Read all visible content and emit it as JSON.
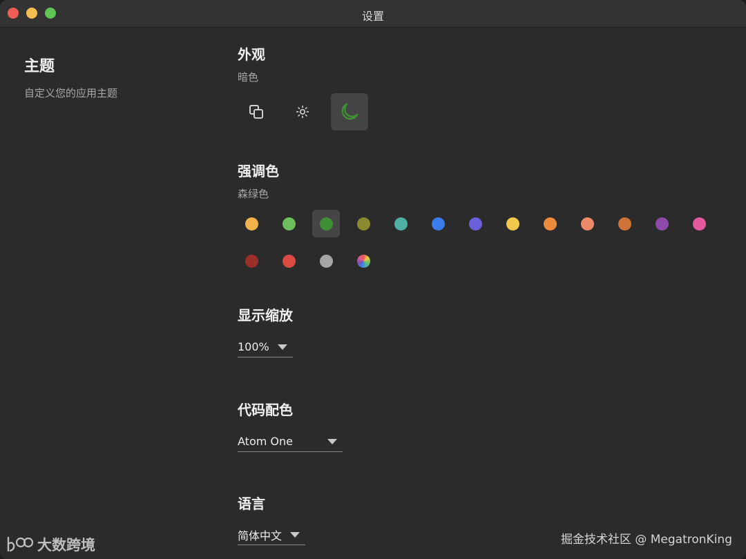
{
  "window": {
    "title": "设置"
  },
  "sidebar": {
    "title": "主题",
    "subtitle": "自定义您的应用主题"
  },
  "appearance": {
    "title": "外观",
    "current": "暗色",
    "modes": [
      {
        "icon": "system-mode-icon",
        "selected": false
      },
      {
        "icon": "sun-icon",
        "selected": false
      },
      {
        "icon": "moon-icon",
        "selected": true
      }
    ]
  },
  "accent": {
    "title": "强调色",
    "current": "森绿色",
    "swatches": [
      {
        "color": "#f0b24a",
        "selected": false
      },
      {
        "color": "#6cbf5a",
        "selected": false
      },
      {
        "color": "#3f8f34",
        "selected": true
      },
      {
        "color": "#8a8a2e",
        "selected": false
      },
      {
        "color": "#4fb0a2",
        "selected": false
      },
      {
        "color": "#3b7bea",
        "selected": false
      },
      {
        "color": "#6a5fd9",
        "selected": false
      },
      {
        "color": "#f2c94c",
        "selected": false
      },
      {
        "color": "#ea8c3c",
        "selected": false
      },
      {
        "color": "#ee8a6a",
        "selected": false
      },
      {
        "color": "#cf7336",
        "selected": false
      },
      {
        "color": "#8e4aa8",
        "selected": false
      },
      {
        "color": "#e55a9c",
        "selected": false
      },
      {
        "color": "#9b2f2a",
        "selected": false
      },
      {
        "color": "#dc4a44",
        "selected": false
      },
      {
        "color": "#a5a5a5",
        "selected": false
      },
      {
        "color": "multicolor",
        "selected": false
      }
    ]
  },
  "scale": {
    "title": "显示缩放",
    "value": "100%"
  },
  "code_theme": {
    "title": "代码配色",
    "value": "Atom One"
  },
  "language": {
    "title": "语言",
    "value": "简体中文"
  },
  "watermarks": {
    "left": "大数跨境",
    "right": "掘金技术社区 @ MegatronKing"
  },
  "colors": {
    "accent": "#3f8f34",
    "background": "#2b2b2b",
    "titlebar": "#333333"
  }
}
